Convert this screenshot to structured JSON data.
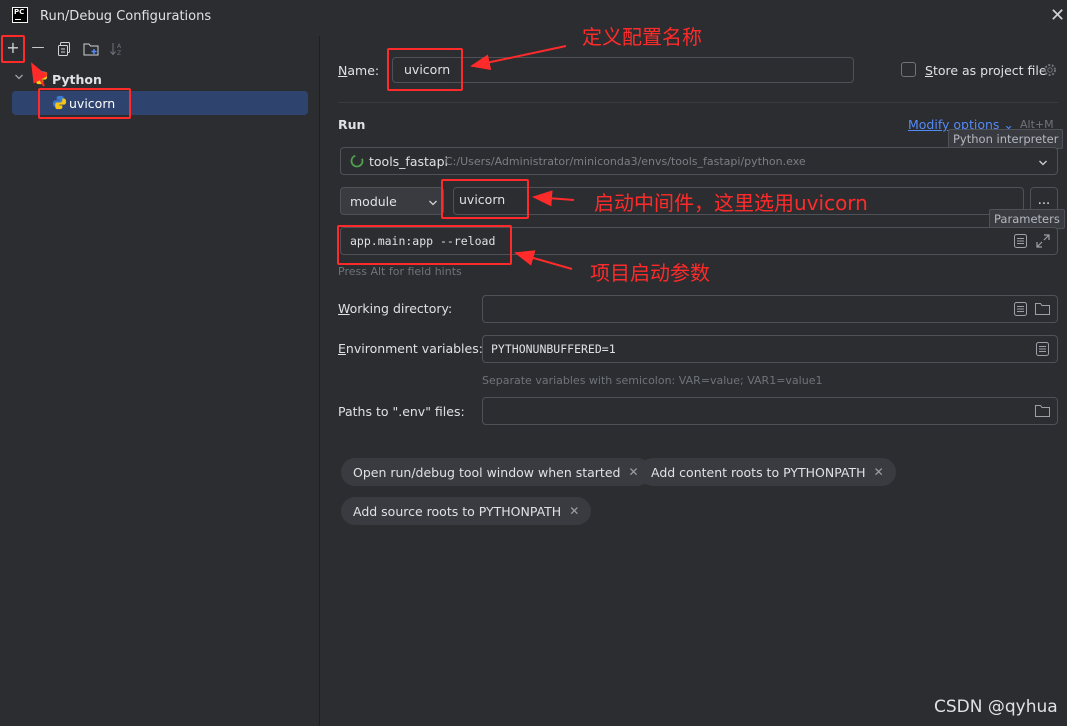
{
  "window": {
    "title": "Run/Debug Configurations",
    "logo_text": "PC"
  },
  "toolbar": {
    "add_label": "+",
    "remove_label": "—"
  },
  "tree": {
    "group_label": "Python",
    "item_label": "uvicorn"
  },
  "form": {
    "name_label": "Name:",
    "name_value": "uvicorn",
    "store_label": "Store as project file",
    "run_section": "Run",
    "modify_options": "Modify options",
    "modify_shortcut": "Alt+M",
    "interpreter_tooltip": "Python interpreter",
    "interpreter_name": "tools_fastapi",
    "interpreter_path": "C:/Users/Administrator/miniconda3/envs/tools_fastapi/python.exe",
    "module_select": "module",
    "module_value": "uvicorn",
    "more_button": "...",
    "parameters_tooltip": "Parameters",
    "parameters_value": "app.main:app --reload",
    "field_hints": "Press Alt for field hints",
    "workdir_label": "Working directory:",
    "workdir_value": "",
    "env_label": "Environment variables:",
    "env_value": "PYTHONUNBUFFERED=1",
    "env_hint": "Separate variables with semicolon: VAR=value; VAR1=value1",
    "dotenv_label": "Paths to \".env\" files:",
    "dotenv_value": ""
  },
  "chips": [
    "Open run/debug tool window when started",
    "Add content roots to PYTHONPATH",
    "Add source roots to PYTHONPATH"
  ],
  "annotations": {
    "name_note": "定义配置名称",
    "module_note": "启动中间件，这里选用uvicorn",
    "params_note": "项目启动参数"
  },
  "watermark": "CSDN @qyhua",
  "colors": {
    "background": "#2b2d30",
    "selection": "#2e436e",
    "link": "#548af7",
    "annotation_red": "#ff2b2b"
  }
}
